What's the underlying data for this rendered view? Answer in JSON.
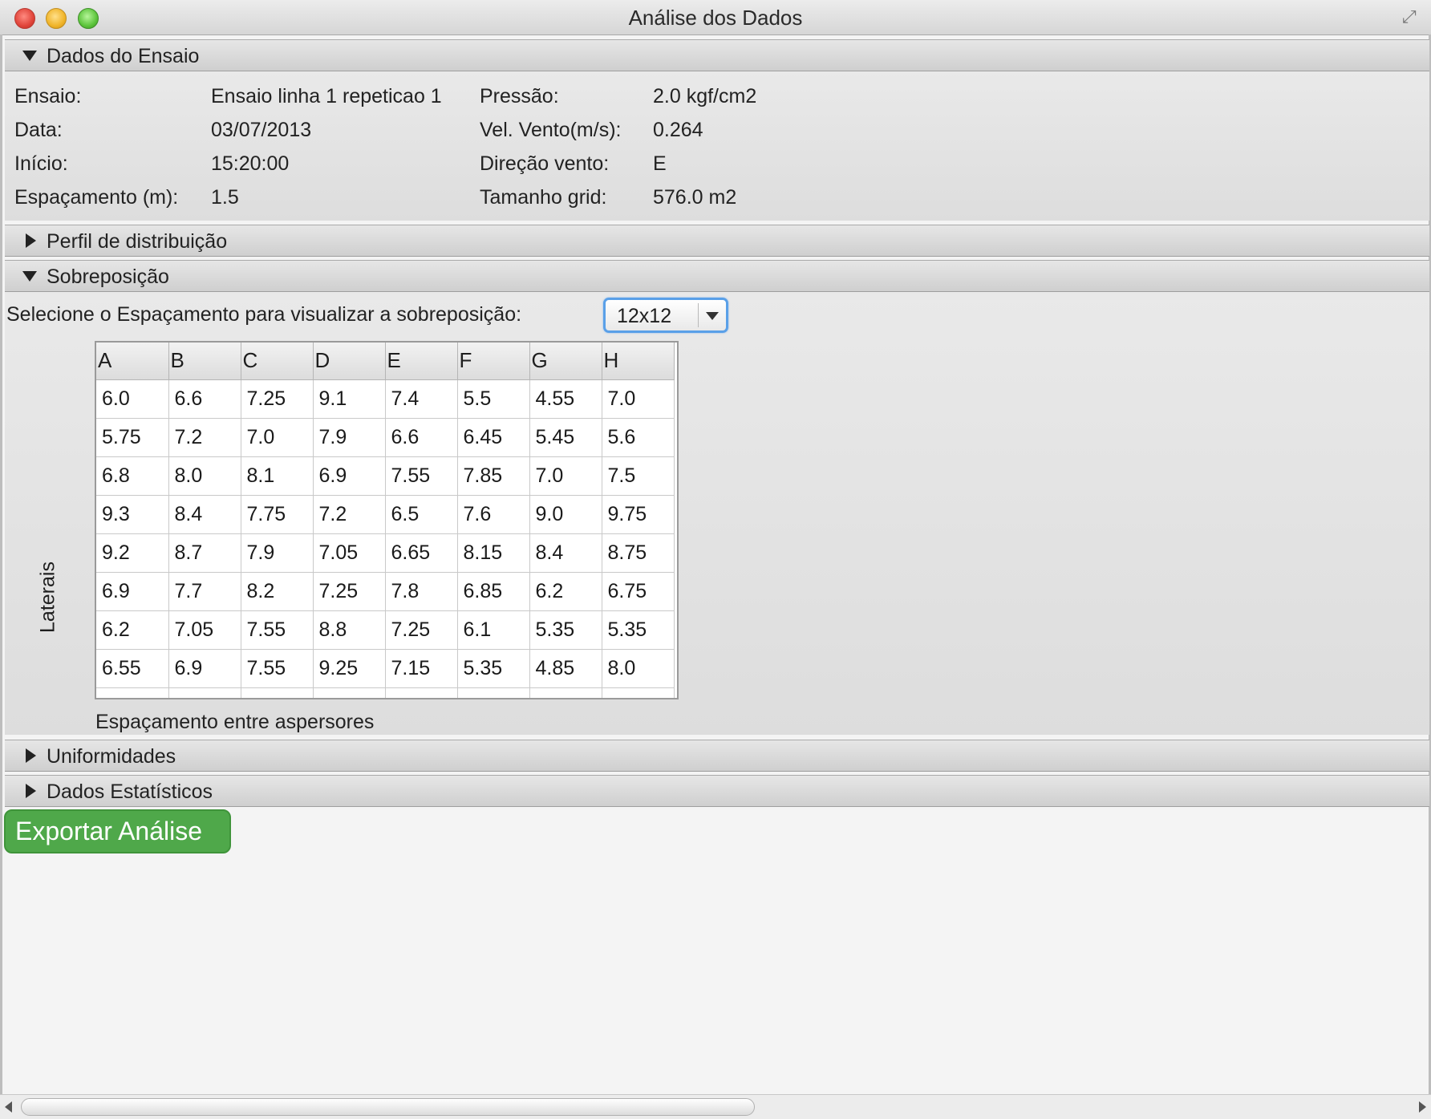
{
  "window": {
    "title": "Análise dos Dados"
  },
  "sections": {
    "dados_ensaio": {
      "header": "Dados do Ensaio",
      "left": [
        {
          "label": "Ensaio:",
          "value": "Ensaio linha 1 repeticao 1"
        },
        {
          "label": "Data:",
          "value": "03/07/2013"
        },
        {
          "label": "Início:",
          "value": "15:20:00"
        },
        {
          "label": "Espaçamento (m):",
          "value": "1.5"
        }
      ],
      "right": [
        {
          "label": "Pressão:",
          "value": "2.0 kgf/cm2"
        },
        {
          "label": "Vel. Vento(m/s):",
          "value": "0.264"
        },
        {
          "label": "Direção vento:",
          "value": "E"
        },
        {
          "label": "Tamanho grid:",
          "value": "576.0 m2"
        }
      ]
    },
    "perfil": {
      "header": "Perfil de distribuição"
    },
    "sobreposicao": {
      "header": "Sobreposição",
      "select_label": "Selecione o Espaçamento para visualizar a sobreposição:",
      "select_value": "12x12",
      "y_axis_label": "Laterais",
      "x_axis_label": "Espaçamento entre aspersores",
      "table": {
        "columns": [
          "A",
          "B",
          "C",
          "D",
          "E",
          "F",
          "G",
          "H"
        ],
        "rows": [
          [
            "6.0",
            "6.6",
            "7.25",
            "9.1",
            "7.4",
            "5.5",
            "4.55",
            "7.0"
          ],
          [
            "5.75",
            "7.2",
            "7.0",
            "7.9",
            "6.6",
            "6.45",
            "5.45",
            "5.6"
          ],
          [
            "6.8",
            "8.0",
            "8.1",
            "6.9",
            "7.55",
            "7.85",
            "7.0",
            "7.5"
          ],
          [
            "9.3",
            "8.4",
            "7.75",
            "7.2",
            "6.5",
            "7.6",
            "9.0",
            "9.75"
          ],
          [
            "9.2",
            "8.7",
            "7.9",
            "7.05",
            "6.65",
            "8.15",
            "8.4",
            "8.75"
          ],
          [
            "6.9",
            "7.7",
            "8.2",
            "7.25",
            "7.8",
            "6.85",
            "6.2",
            "6.75"
          ],
          [
            "6.2",
            "7.05",
            "7.55",
            "8.8",
            "7.25",
            "6.1",
            "5.35",
            "5.35"
          ],
          [
            "6.55",
            "6.9",
            "7.55",
            "9.25",
            "7.15",
            "5.35",
            "4.85",
            "8.0"
          ]
        ]
      }
    },
    "uniformidades": {
      "header": "Uniformidades"
    },
    "estatisticos": {
      "header": "Dados Estatísticos"
    }
  },
  "export_button": "Exportar Análise"
}
